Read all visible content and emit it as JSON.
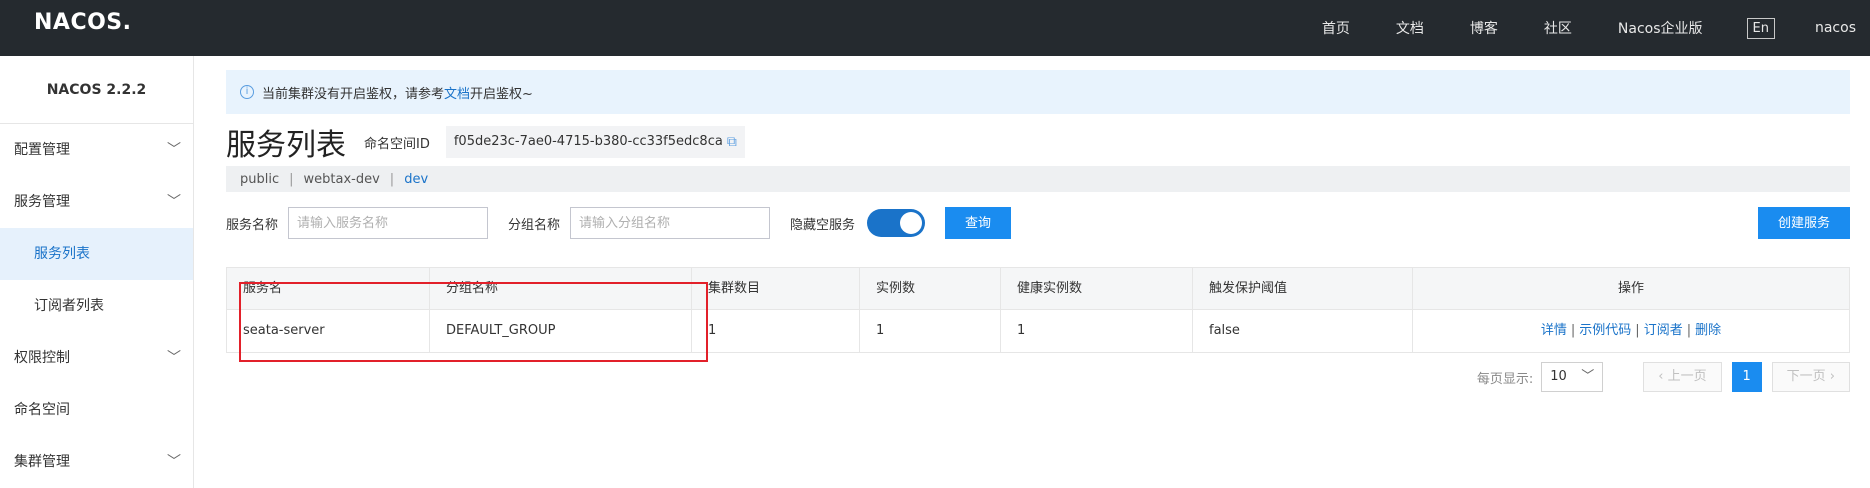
{
  "header": {
    "logo": "NACOS.",
    "nav": [
      "首页",
      "文档",
      "博客",
      "社区",
      "Nacos企业版"
    ],
    "lang": "En",
    "user": "nacos"
  },
  "sidebar": {
    "version": "NACOS 2.2.2",
    "items": [
      {
        "label": "配置管理",
        "chevron": true
      },
      {
        "label": "服务管理",
        "chevron": true
      },
      {
        "label": "服务列表",
        "sub": true,
        "active": true
      },
      {
        "label": "订阅者列表",
        "sub": true
      },
      {
        "label": "权限控制",
        "chevron": true
      },
      {
        "label": "命名空间"
      },
      {
        "label": "集群管理",
        "chevron": true
      }
    ]
  },
  "notice": {
    "icon": "info-icon",
    "prefix": "当前集群没有开启鉴权，请参考",
    "link": "文档",
    "suffix": "开启鉴权~"
  },
  "page": {
    "title": "服务列表",
    "namespace_label": "命名空间ID",
    "namespace_id": "f05de23c-7ae0-4715-b380-cc33f5edc8ca",
    "namespaces": [
      "public",
      "webtax-dev",
      "dev"
    ],
    "current_namespace": "dev"
  },
  "filters": {
    "service_label": "服务名称",
    "service_placeholder": "请输入服务名称",
    "group_label": "分组名称",
    "group_placeholder": "请输入分组名称",
    "hide_empty_label": "隐藏空服务",
    "hide_empty_on": true,
    "query_button": "查询",
    "create_button": "创建服务"
  },
  "table": {
    "headers": [
      "服务名",
      "分组名称",
      "集群数目",
      "实例数",
      "健康实例数",
      "触发保护阈值",
      "操作"
    ],
    "rows": [
      {
        "service": "seata-server",
        "group": "DEFAULT_GROUP",
        "clusters": "1",
        "instances": "1",
        "healthy": "1",
        "threshold": "false",
        "ops": [
          "详情",
          "示例代码",
          "订阅者",
          "删除"
        ]
      }
    ]
  },
  "pager": {
    "per_page_label": "每页显示:",
    "per_page": "10",
    "prev": "上一页",
    "next": "下一页",
    "current": "1"
  },
  "colors": {
    "accent": "#1a8cf0",
    "header_bg": "#252a2f",
    "highlight": "#e2202a"
  }
}
